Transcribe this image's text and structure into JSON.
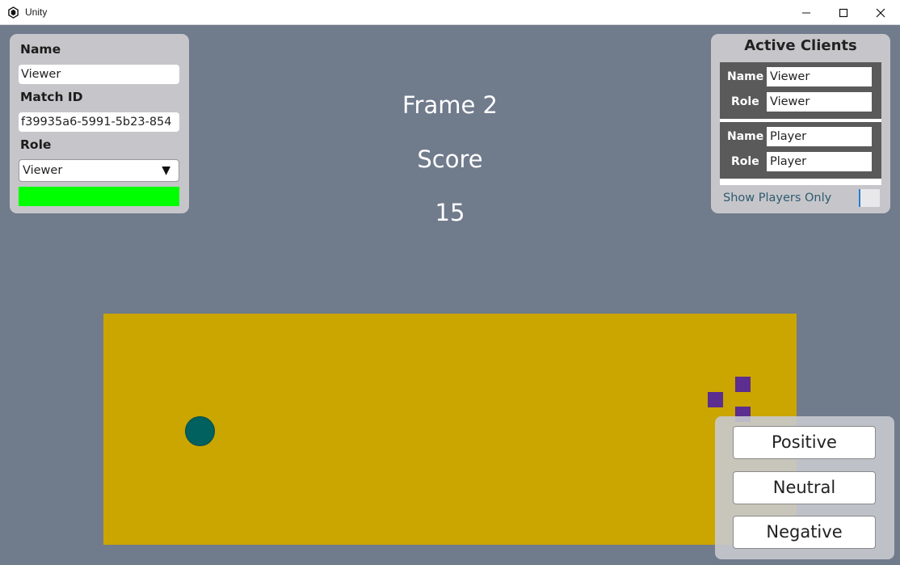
{
  "window": {
    "title": "Unity",
    "app_icon": "unity-icon",
    "controls": [
      "minimize-icon",
      "maximize-icon",
      "close-icon"
    ]
  },
  "left_panel": {
    "name_label": "Name",
    "name_value": "Viewer",
    "match_id_label": "Match ID",
    "match_id_value": "f39935a6-5991-5b23-854",
    "role_label": "Role",
    "role_value": "Viewer",
    "status_color": "#00ff00"
  },
  "hud": {
    "frame": "Frame 2",
    "score_label": "Score",
    "score_value": "15"
  },
  "active_clients": {
    "title": "Active Clients",
    "clients": [
      {
        "name_label": "Name",
        "name": "Viewer",
        "role_label": "Role",
        "role": "Viewer"
      },
      {
        "name_label": "Name",
        "name": "Player",
        "role_label": "Role",
        "role": "Player"
      }
    ],
    "show_players_only_label": "Show Players Only",
    "show_players_only": false
  },
  "feedback": {
    "positive": "Positive",
    "neutral": "Neutral",
    "negative": "Negative"
  },
  "colors": {
    "background": "#707b8c",
    "field": "#cba500",
    "ball": "#00615e",
    "blocks": "#5b2e8f"
  }
}
